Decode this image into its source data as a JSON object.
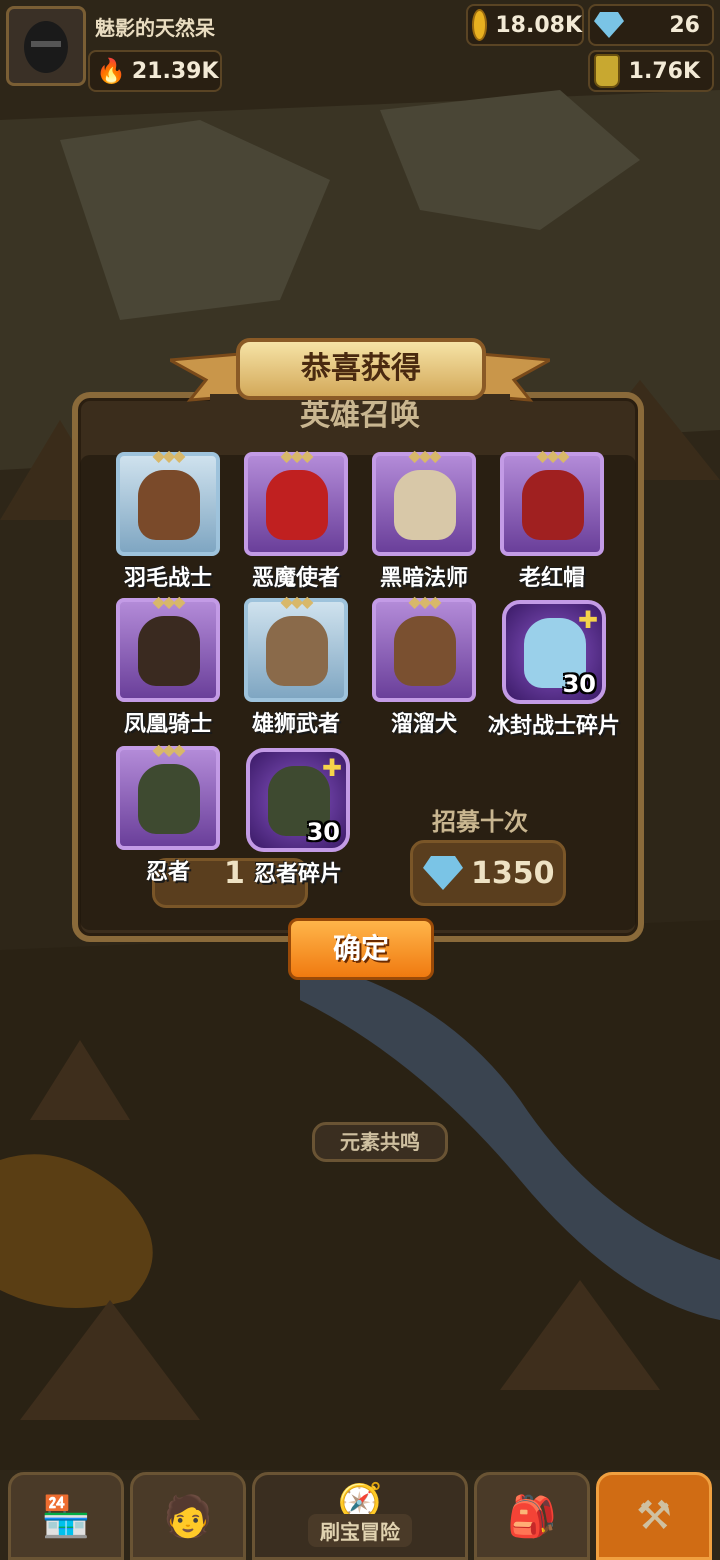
{
  "player": {
    "name": "魅影的天然呆",
    "power": "21.39K"
  },
  "currencies": {
    "gold": "18.08K",
    "gems": "26",
    "potion": "1.76K"
  },
  "dialog": {
    "title": "恭喜获得",
    "subtitle": "英雄召唤",
    "confirm_label": "确定",
    "rewards": [
      {
        "name": "羽毛战士",
        "rarity": "blue"
      },
      {
        "name": "恶魔使者",
        "rarity": "purple"
      },
      {
        "name": "黑暗法师",
        "rarity": "purple"
      },
      {
        "name": "老红帽",
        "rarity": "purple"
      },
      {
        "name": "凤凰骑士",
        "rarity": "purple"
      },
      {
        "name": "雄狮武者",
        "rarity": "blue"
      },
      {
        "name": "溜溜犬",
        "rarity": "purple"
      },
      {
        "name": "冰封战士碎片",
        "rarity": "fragment",
        "count": "30"
      },
      {
        "name": "忍者",
        "rarity": "purple"
      },
      {
        "name": "忍者碎片",
        "rarity": "fragment",
        "count": "30"
      }
    ]
  },
  "behind": {
    "recruit_ten_label": "招募十次",
    "recruit_ten_cost": "1350",
    "recruit_one_cost_partial": "1",
    "element_label": "元素共鸣",
    "adventure_label": "刷宝冒险"
  },
  "tabs": [
    "shop-icon",
    "hero-icon",
    "adventure-icon",
    "chest-icon",
    "forge-icon"
  ],
  "colors": {
    "accent_orange": "#f07a10",
    "purple_rarity": "#6a3f9a",
    "blue_rarity": "#7fa6c2"
  }
}
